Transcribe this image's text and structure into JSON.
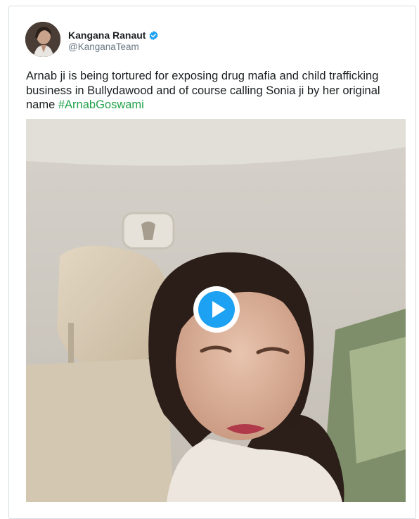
{
  "tweet": {
    "author": {
      "name": "Kangana Ranaut",
      "handle": "@KanganaTeam",
      "verified": true
    },
    "text": "Arnab ji is being tortured for exposing drug mafia and child trafficking business in Bullydawood and of course calling Sonia ji by her original name",
    "hashtag": "#ArnabGoswami",
    "media": {
      "kind": "video",
      "play_icon": "play-icon"
    }
  },
  "colors": {
    "text": "#1c2022",
    "handle": "#697882",
    "hashtag": "#22a24b",
    "verified": "#1da1f2",
    "play_accent": "#1da1f2"
  }
}
